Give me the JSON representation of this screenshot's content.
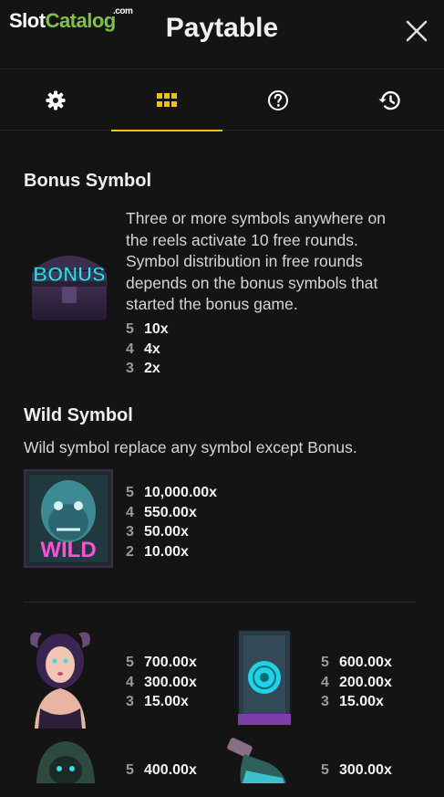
{
  "header": {
    "logo": {
      "part1": "Slot",
      "part2": "Catalog",
      "suffix": ".com"
    },
    "title": "Paytable",
    "close_icon": "close-icon"
  },
  "tabs": [
    {
      "icon": "gear-icon",
      "active": false
    },
    {
      "icon": "grid-icon",
      "active": true
    },
    {
      "icon": "help-icon",
      "active": false
    },
    {
      "icon": "history-icon",
      "active": false
    }
  ],
  "colors": {
    "accent": "#e8c21e",
    "logo_green": "#7fc243",
    "background": "#141414"
  },
  "bonus": {
    "title": "Bonus Symbol",
    "description": [
      "Three or more symbols anywhere on",
      "the reels activate 10 free rounds.",
      "Symbol distribution in free rounds",
      "depends on the bonus symbols that",
      "started the bonus game."
    ],
    "pays": [
      {
        "count": "5",
        "mult": "10x"
      },
      {
        "count": "4",
        "mult": "4x"
      },
      {
        "count": "3",
        "mult": "2x"
      }
    ]
  },
  "wild": {
    "title": "Wild Symbol",
    "description": "Wild symbol replace any symbol except Bonus.",
    "icon_text": "WILD",
    "pays": [
      {
        "count": "5",
        "mult": "10,000.00x"
      },
      {
        "count": "4",
        "mult": "550.00x"
      },
      {
        "count": "3",
        "mult": "50.00x"
      },
      {
        "count": "2",
        "mult": "10.00x"
      }
    ]
  },
  "symbols": [
    {
      "icon": "demon-girl-icon",
      "pays": [
        {
          "count": "5",
          "mult": "700.00x"
        },
        {
          "count": "4",
          "mult": "300.00x"
        },
        {
          "count": "3",
          "mult": "15.00x"
        }
      ]
    },
    {
      "icon": "rune-book-icon",
      "pays": [
        {
          "count": "5",
          "mult": "600.00x"
        },
        {
          "count": "4",
          "mult": "200.00x"
        },
        {
          "count": "3",
          "mult": "15.00x"
        }
      ]
    },
    {
      "icon": "hooded-skull-icon",
      "pays": [
        {
          "count": "5",
          "mult": "400.00x"
        }
      ]
    },
    {
      "icon": "potion-bottle-icon",
      "pays": [
        {
          "count": "5",
          "mult": "300.00x"
        }
      ]
    }
  ]
}
